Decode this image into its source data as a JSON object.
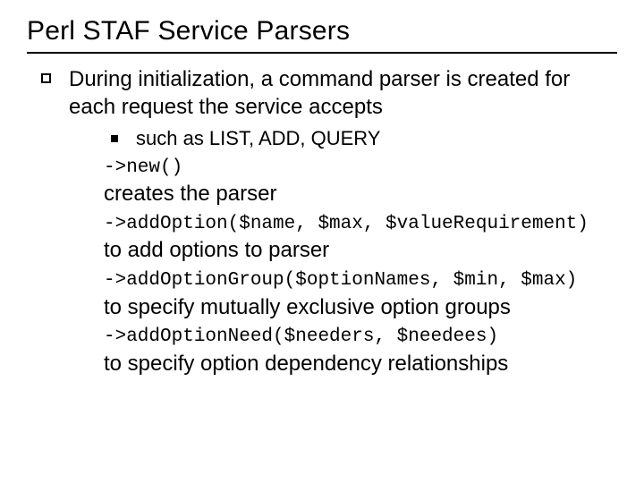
{
  "title": "Perl STAF Service Parsers",
  "bullet1": "During initialization, a command parser is created for each request the service accepts",
  "sub1": "such as LIST, ADD, QUERY",
  "code1": "->new()",
  "desc1": "creates the parser",
  "code2": "->addOption($name, $max, $valueRequirement)",
  "desc2": "to add options to parser",
  "code3": "->addOptionGroup($optionNames, $min, $max)",
  "desc3": "to specify mutually exclusive option groups",
  "code4": "->addOptionNeed($needers, $needees)",
  "desc4": "to specify option dependency relationships"
}
